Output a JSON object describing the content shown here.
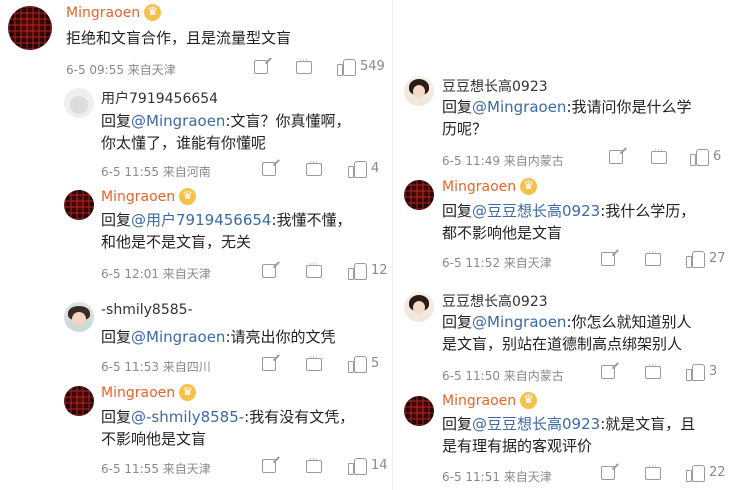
{
  "left": {
    "top_comment": {
      "user": "Mingraoen",
      "text": "拒绝和文盲合作，且是流量型文盲",
      "meta": "6-5 09:55  来自天津",
      "likes": "549"
    },
    "replies": [
      {
        "user": "用户7919456654",
        "prefix": "回复",
        "mention": "@Mingraoen",
        "body_line1": ":文盲？你真懂啊，",
        "body_line2": "你太懂了，谁能有你懂呢",
        "meta": "6-5 11:55  来自河南",
        "likes": "4"
      },
      {
        "user": "Mingraoen",
        "prefix": "回复",
        "mention": "@用户7919456654",
        "body_line1": ":我懂不懂，",
        "body_line2": "和他是不是文盲，无关",
        "meta": "6-5 12:01  来自天津",
        "likes": "12"
      },
      {
        "user": "-shmily8585-",
        "prefix": "回复",
        "mention": "@Mingraoen",
        "body_line1": ":请亮出你的文凭",
        "body_line2": "",
        "meta": "6-5 11:53  来自四川",
        "likes": "5"
      },
      {
        "user": "Mingraoen",
        "prefix": "回复",
        "mention": "@-shmily8585-",
        "body_line1": ":我有没有文凭，",
        "body_line2": "不影响他是文盲",
        "meta": "6-5 11:55  来自天津",
        "likes": "14"
      }
    ]
  },
  "right": {
    "replies": [
      {
        "user": "豆豆想长高0923",
        "prefix": "回复",
        "mention": "@Mingraoen",
        "body_line1": ":我请问你是什么学",
        "body_line2": "历呢？",
        "meta": "6-5 11:49  来自内蒙古",
        "likes": "6"
      },
      {
        "user": "Mingraoen",
        "prefix": "回复",
        "mention": "@豆豆想长高0923",
        "body_line1": ":我什么学历，",
        "body_line2": "都不影响他是文盲",
        "meta": "6-5 11:52  来自天津",
        "likes": "27"
      },
      {
        "user": "豆豆想长高0923",
        "prefix": "回复",
        "mention": "@Mingraoen",
        "body_line1": ":你怎么就知道别人",
        "body_line2": "是文盲，别站在道德制高点绑架别人",
        "meta": "6-5 11:50  来自内蒙古",
        "likes": "3"
      },
      {
        "user": "Mingraoen",
        "prefix": "回复",
        "mention": "@豆豆想长高0923",
        "body_line1": ":就是文盲，且",
        "body_line2": "是有理有据的客观评价",
        "meta": "6-5 11:51  来自天津",
        "likes": "22"
      }
    ]
  },
  "icons": {
    "share": "share-icon",
    "comment": "comment-icon",
    "like": "like-icon",
    "crown": "crown-badge-icon"
  },
  "colors": {
    "vip_name": "#e8642b",
    "mention": "#3b6aa8",
    "meta": "#8a8a8a"
  }
}
